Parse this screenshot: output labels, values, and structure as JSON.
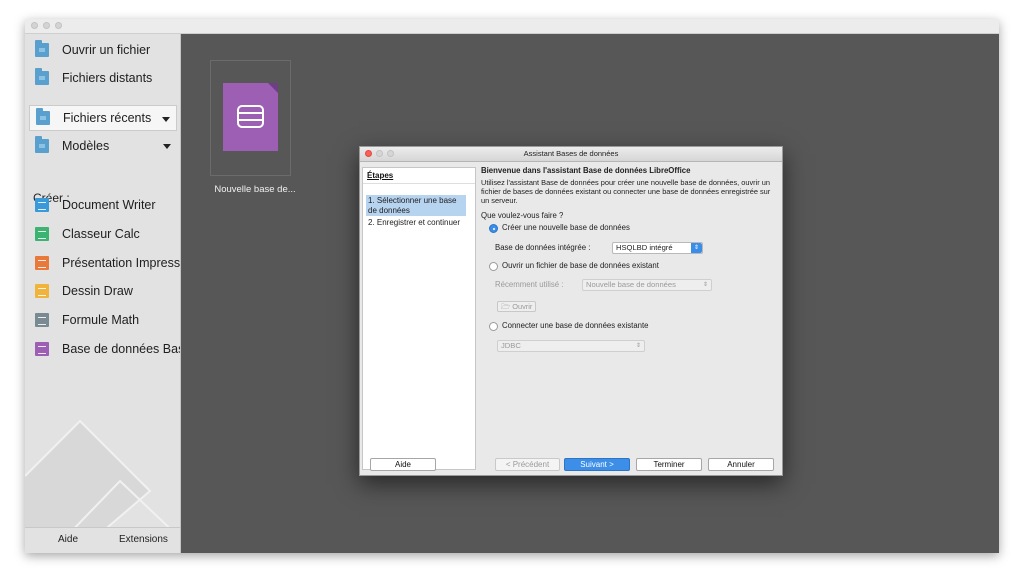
{
  "sidebar": {
    "ouvrir_fichier": "Ouvrir un fichier",
    "fichiers_distants": "Fichiers distants",
    "fichiers_recents": "Fichiers récents",
    "modeles": "Modèles",
    "creer": "Créer :",
    "writer": "Document Writer",
    "calc": "Classeur Calc",
    "impress": "Présentation Impress",
    "draw": "Dessin Draw",
    "math": "Formule Math",
    "base": "Base de données Base",
    "aide": "Aide",
    "extensions": "Extensions"
  },
  "recent": {
    "thumb_label": "Nouvelle base de..."
  },
  "dialog": {
    "title": "Assistant Bases de données",
    "steps_heading": "Étapes",
    "step1": "1. Sélectionner une base de données",
    "step2": "2. Enregistrer et continuer",
    "heading": "Bienvenue dans l'assistant Base de données LibreOffice",
    "intro": "Utilisez l'assistant Base de données pour créer une nouvelle base de données, ouvrir un fichier de bases de données existant ou connecter une base de données enregistrée sur un serveur.",
    "question": "Que voulez-vous faire ?",
    "opt_create": "Créer une nouvelle base de données",
    "embedded_label": "Base de données intégrée :",
    "embedded_value": "HSQLBD intégré",
    "opt_open": "Ouvrir un fichier de base de données existant",
    "recent_label": "Récemment utilisé :",
    "recent_value": "Nouvelle base de données",
    "open_btn": "Ouvrir",
    "opt_connect": "Connecter une base de données existante",
    "connect_value": "JDBC",
    "btn_help": "Aide",
    "btn_prev": "< Précédent",
    "btn_next": "Suivant >",
    "btn_finish": "Terminer",
    "btn_cancel": "Annuler"
  },
  "colors": {
    "accent": "#3b8ee8",
    "base_icon": "#9c5fb3",
    "folder": "#5aa0cf",
    "writer": "#3a9ad9",
    "calc": "#3cb371",
    "impress": "#e8793b",
    "draw": "#f0b43c",
    "math": "#7a8a92",
    "base": "#9c5fb3"
  },
  "icons": [
    "folder-icon",
    "writer-icon",
    "calc-icon",
    "impress-icon",
    "draw-icon",
    "math-icon",
    "base-icon",
    "database-icon"
  ]
}
